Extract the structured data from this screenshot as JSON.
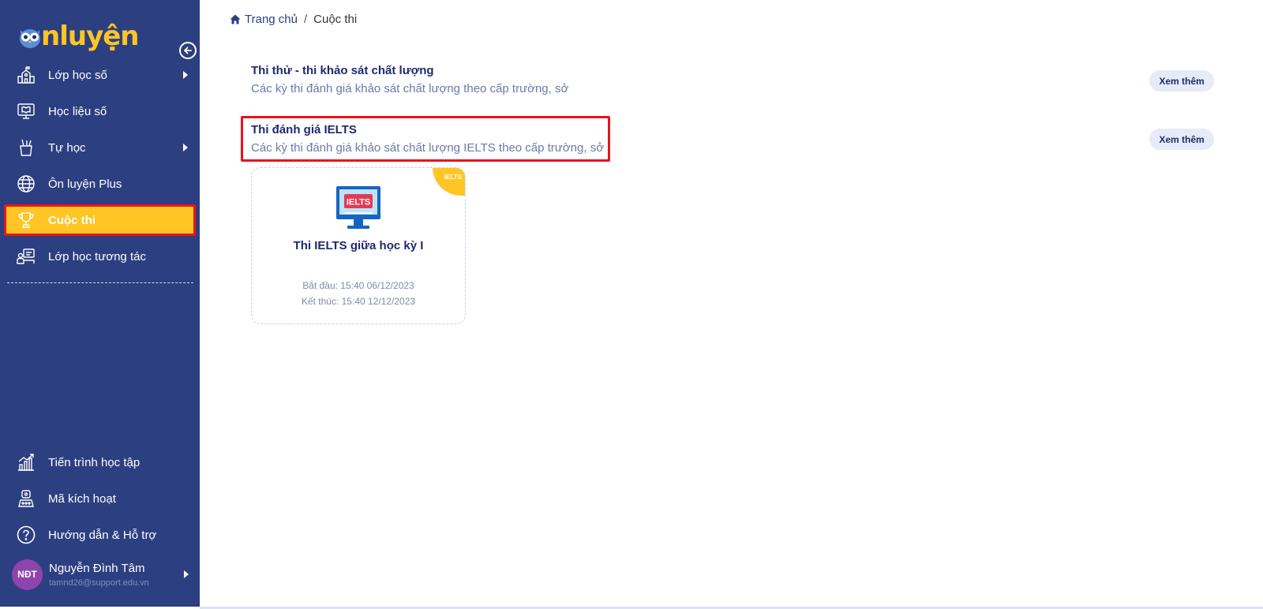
{
  "logo": {
    "text": "nluyện"
  },
  "sidebar": {
    "items": [
      {
        "label": "Lớp học số",
        "icon": "school-icon",
        "has_submenu": true
      },
      {
        "label": "Học liệu số",
        "icon": "monitor-book-icon",
        "has_submenu": false
      },
      {
        "label": "Tự học",
        "icon": "pencil-cup-icon",
        "has_submenu": true
      },
      {
        "label": "Ôn luyện Plus",
        "icon": "globe-icon",
        "has_submenu": false
      },
      {
        "label": "Cuộc thi",
        "icon": "trophy-icon",
        "has_submenu": false,
        "active": true
      },
      {
        "label": "Lớp học tương tác",
        "icon": "interactive-class-icon",
        "has_submenu": false
      }
    ],
    "bottom_items": [
      {
        "label": "Tiến trình học tập",
        "icon": "chart-icon"
      },
      {
        "label": "Mã kích hoạt",
        "icon": "activation-key-icon"
      },
      {
        "label": "Hướng dẫn & Hỗ trợ",
        "icon": "help-icon"
      }
    ],
    "user": {
      "initials": "NĐT",
      "name": "Nguyễn Đình Tâm",
      "email": "tamnd26@support.edu.vn"
    }
  },
  "breadcrumb": {
    "home": "Trang chủ",
    "separator": "/",
    "current": "Cuộc thi"
  },
  "sections": [
    {
      "title": "Thi thử - thi khảo sát chất lượng",
      "desc": "Các kỳ thi đánh giá khảo sát chất lượng theo cấp trường, sở",
      "more": "Xem thêm"
    },
    {
      "title": "Thi đánh giá IELTS",
      "desc": "Các kỳ thi đánh giá khảo sát chất lượng IELTS theo cấp trường, sở",
      "more": "Xem thêm"
    }
  ],
  "card": {
    "badge": "IELTS",
    "screen_text": "IELTS",
    "title": "Thi IELTS giữa học kỳ I",
    "start": "Bắt đầu: 15:40 06/12/2023",
    "end": "Kết thúc: 15:40 12/12/2023"
  },
  "colors": {
    "sidebar": "#2c3f80",
    "accent": "#ffc524",
    "highlight": "#e8141c"
  }
}
